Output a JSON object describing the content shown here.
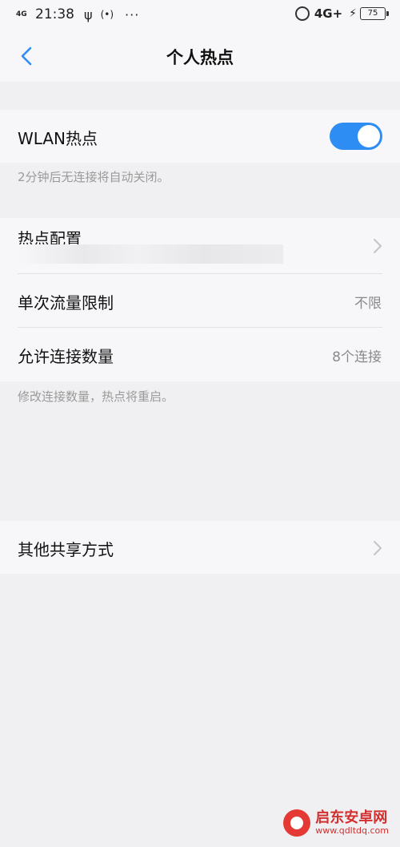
{
  "status_bar": {
    "network_left": "4G",
    "time": "21:38",
    "usb_icon": "usb-icon",
    "radio_icon": "hotspot-signal-icon",
    "more": "···",
    "network_right": "4G+",
    "battery": "75"
  },
  "header": {
    "title": "个人热点",
    "back_icon": "chevron-left-icon"
  },
  "wlan": {
    "label": "WLAN热点",
    "toggle_on": true,
    "note": "2分钟后无连接将自动关闭。"
  },
  "settings": {
    "hotspot_config_label": "热点配置",
    "data_limit_label": "单次流量限制",
    "data_limit_value": "不限",
    "max_connections_label": "允许连接数量",
    "max_connections_value": "8个连接",
    "note": "修改连接数量，热点将重启。"
  },
  "other": {
    "label": "其他共享方式"
  },
  "watermark": {
    "name": "启东安卓网",
    "url": "www.qdltdq.com"
  },
  "colors": {
    "accent": "#2e8df3",
    "background": "#f0f0f2",
    "card": "#f7f7f9"
  }
}
